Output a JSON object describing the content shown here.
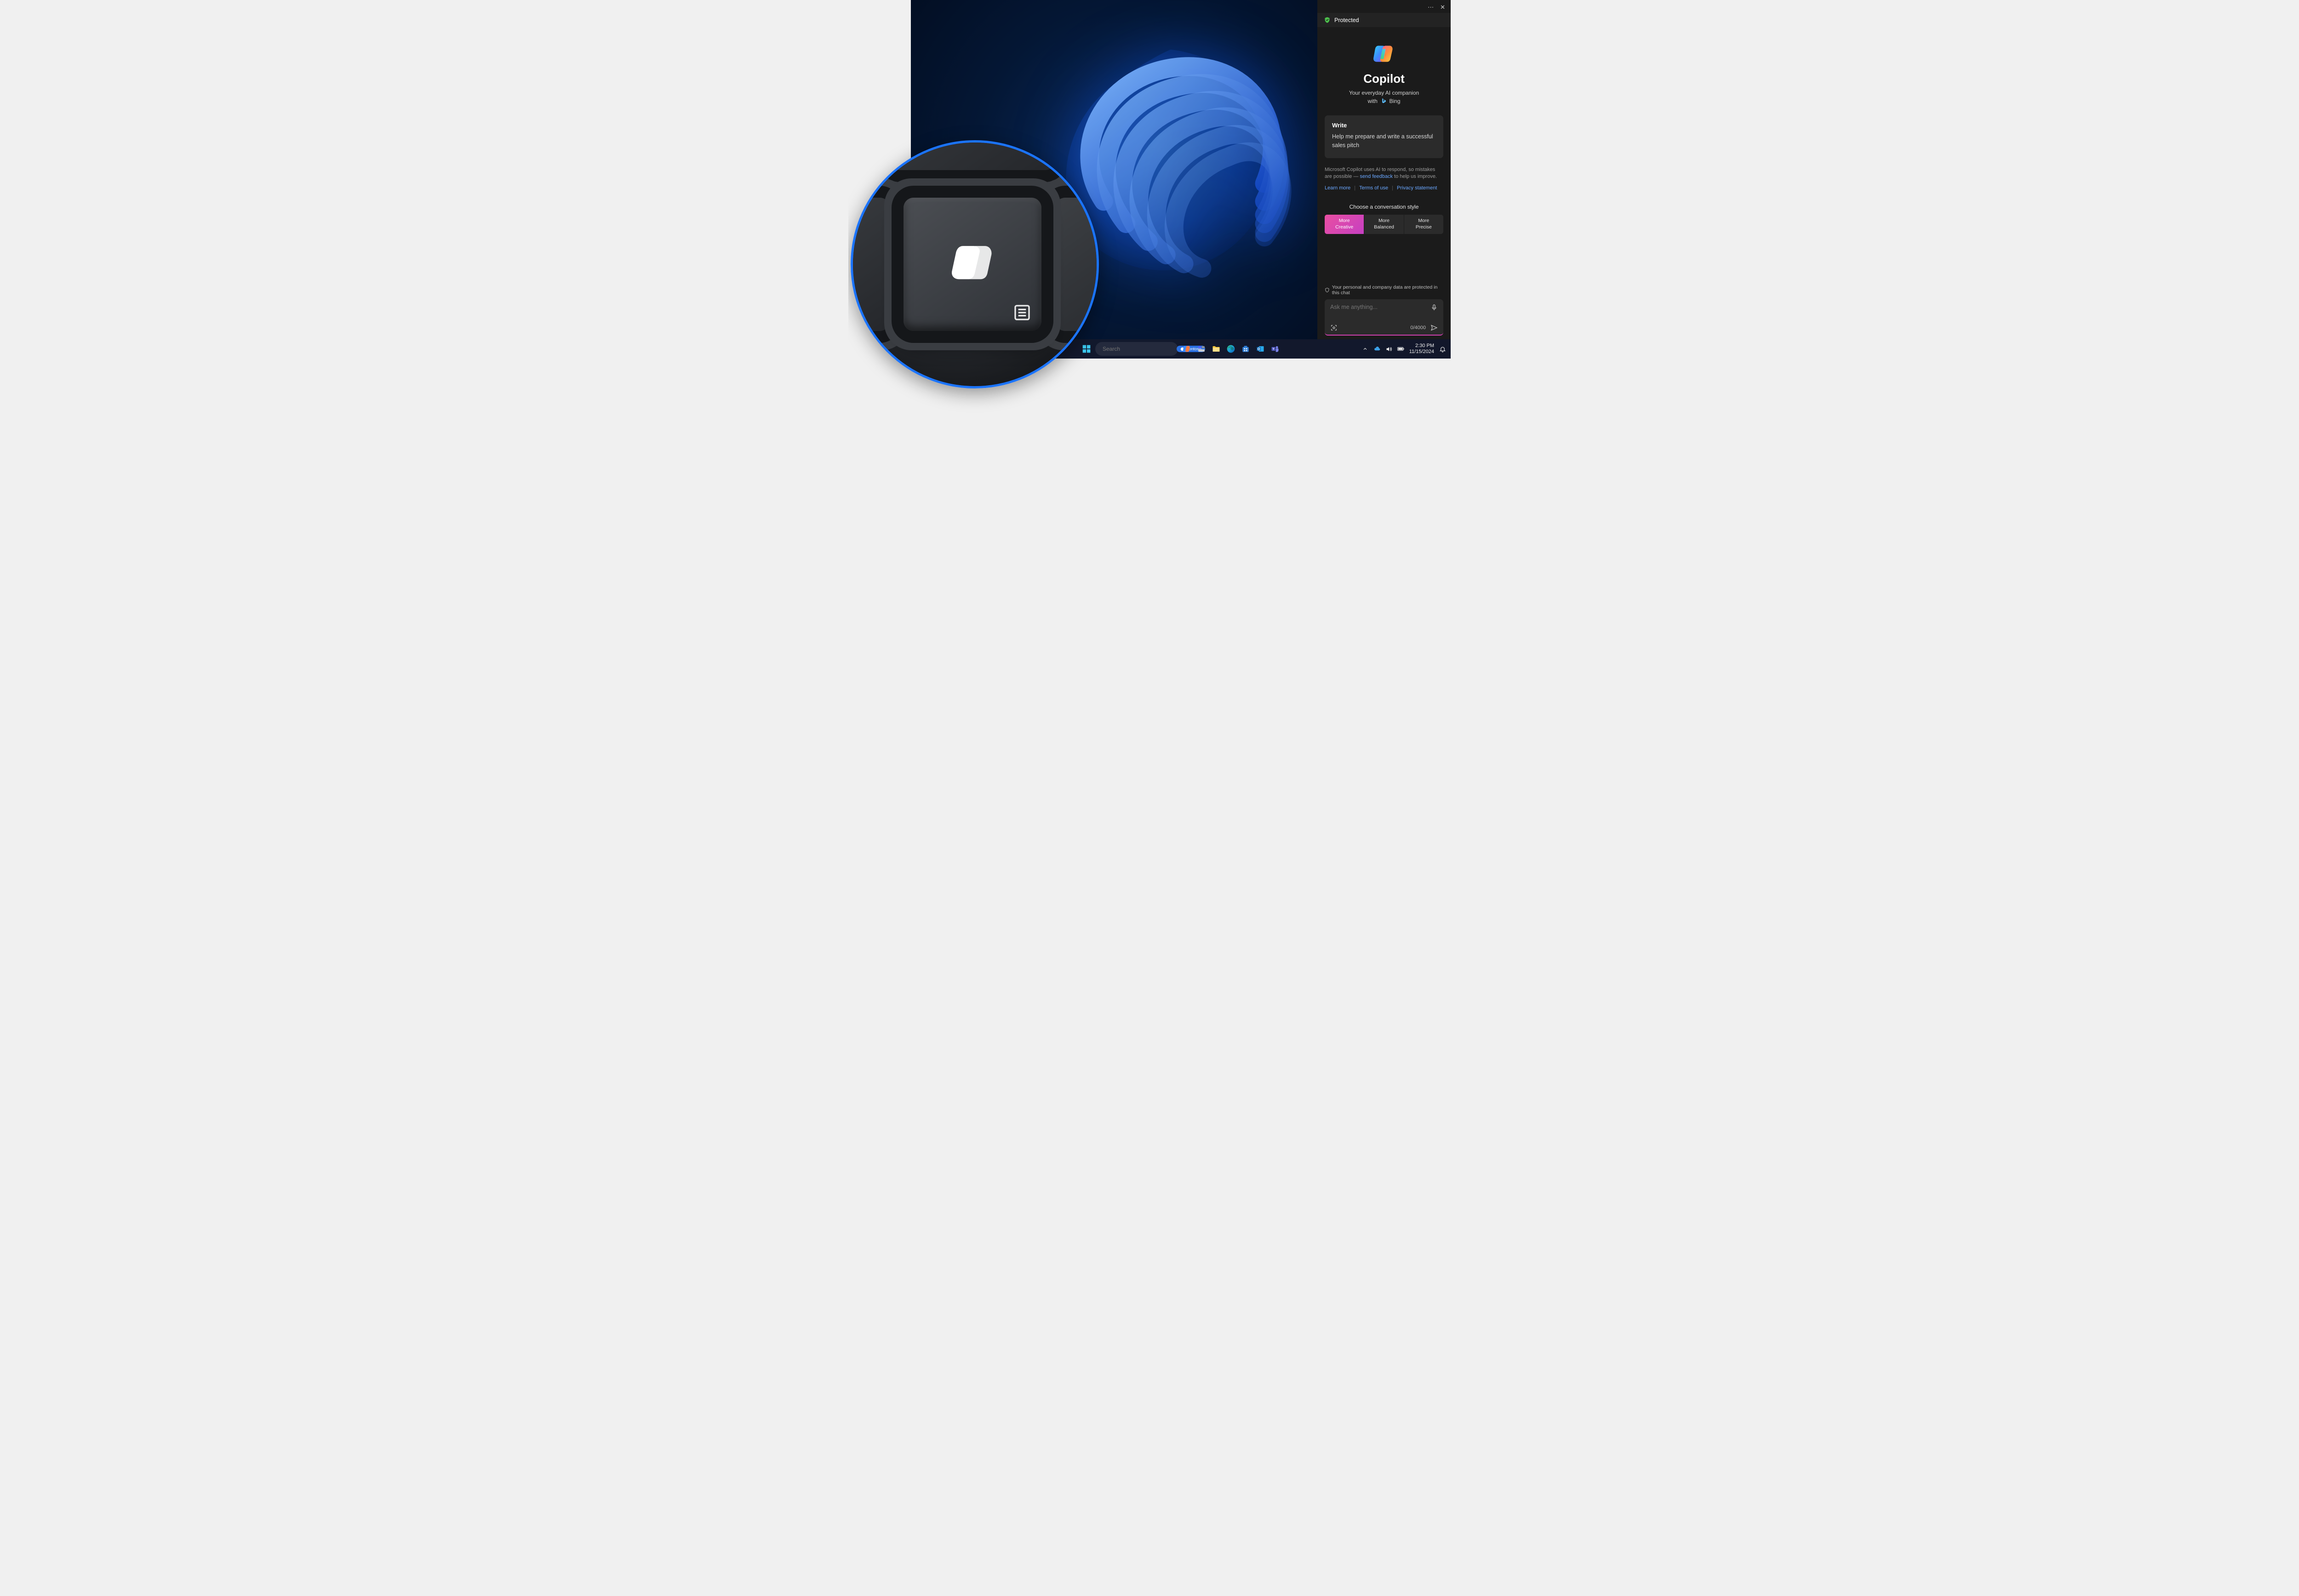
{
  "copilot": {
    "protected_label": "Protected",
    "title": "Copilot",
    "subtitle": "Your everyday AI companion",
    "with_prefix": "with",
    "with_brand": "Bing",
    "card": {
      "title": "Write",
      "body": "Help me prepare and write a successful sales pitch"
    },
    "disclaimer_a": "Microsoft Copilot uses AI to respond, so mistakes are possible — ",
    "disclaimer_link": "send feedback",
    "disclaimer_b": " to help us improve.",
    "links": {
      "learn_more": "Learn more",
      "terms": "Terms of use",
      "privacy": "Privacy statement"
    },
    "style_label": "Choose a conversation style",
    "styles": [
      {
        "top": "More",
        "bottom": "Creative",
        "active": true
      },
      {
        "top": "More",
        "bottom": "Balanced",
        "active": false
      },
      {
        "top": "More",
        "bottom": "Precise",
        "active": false
      }
    ],
    "protect_note": "Your personal and company data are protected in this chat",
    "input_placeholder": "Ask me anything...",
    "char_counter": "0/4000"
  },
  "taskbar": {
    "search_placeholder": "Search",
    "org_badge": "Contoso",
    "time": "2:30 PM",
    "date": "11/15/2024"
  },
  "colors": {
    "accent_pink": "#d040b0",
    "link_blue": "#6aa7ff",
    "circle_border": "#1b74ff",
    "shield_green": "#4cbf4c"
  }
}
